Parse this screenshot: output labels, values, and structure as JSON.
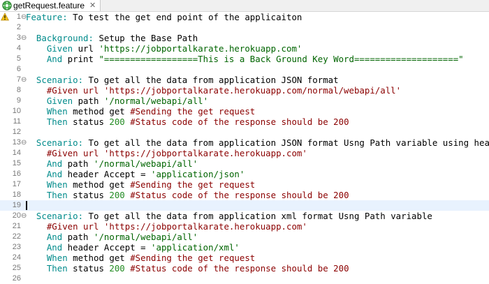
{
  "tab": {
    "title": "getRequest.feature",
    "close_icon": "✕",
    "icon": "cucumber-feature-icon"
  },
  "gutter": {
    "warning_icon": "warning-icon"
  },
  "colors": {
    "keyword": "#008b8b",
    "comment": "#8b0000",
    "string": "#006400",
    "number": "#228b22",
    "text": "#000000",
    "current_line": "#e8f2fe"
  },
  "current_line": 19,
  "lines": [
    {
      "num": "1",
      "fold": true,
      "warn": true,
      "tokens": [
        {
          "c": "kw",
          "t": "Feature:"
        },
        {
          "c": "tx",
          "t": " To test the get end point of the applicaiton"
        }
      ]
    },
    {
      "num": "2",
      "tokens": []
    },
    {
      "num": "3",
      "fold": true,
      "tokens": [
        {
          "c": "kw",
          "t": "  Background:"
        },
        {
          "c": "tx",
          "t": " Setup the Base Path"
        }
      ]
    },
    {
      "num": "4",
      "tokens": [
        {
          "c": "kw",
          "t": "    Given"
        },
        {
          "c": "tx",
          "t": " url "
        },
        {
          "c": "st",
          "t": "'https://jobportalkarate.herokuapp.com'"
        }
      ]
    },
    {
      "num": "5",
      "tokens": [
        {
          "c": "kw",
          "t": "    And"
        },
        {
          "c": "tx",
          "t": " print "
        },
        {
          "c": "st",
          "t": "\"==================This is a Back Ground Key Word====================\""
        }
      ]
    },
    {
      "num": "6",
      "tokens": []
    },
    {
      "num": "7",
      "fold": true,
      "tokens": [
        {
          "c": "kw",
          "t": "  Scenario:"
        },
        {
          "c": "tx",
          "t": " To get all the data from application JSON format"
        }
      ]
    },
    {
      "num": "8",
      "tokens": [
        {
          "c": "cm",
          "t": "    #Given url 'https://jobportalkarate.herokuapp.com/normal/webapi/all'"
        }
      ]
    },
    {
      "num": "9",
      "tokens": [
        {
          "c": "kw",
          "t": "    Given"
        },
        {
          "c": "tx",
          "t": " path "
        },
        {
          "c": "st",
          "t": "'/normal/webapi/all'"
        }
      ]
    },
    {
      "num": "10",
      "tokens": [
        {
          "c": "kw",
          "t": "    When"
        },
        {
          "c": "tx",
          "t": " method get "
        },
        {
          "c": "cm",
          "t": "#Sending the get request"
        }
      ]
    },
    {
      "num": "11",
      "tokens": [
        {
          "c": "kw",
          "t": "    Then"
        },
        {
          "c": "tx",
          "t": " status "
        },
        {
          "c": "nm",
          "t": "200"
        },
        {
          "c": "tx",
          "t": " "
        },
        {
          "c": "cm",
          "t": "#Status code of the response should be 200"
        }
      ]
    },
    {
      "num": "12",
      "tokens": []
    },
    {
      "num": "13",
      "fold": true,
      "tokens": [
        {
          "c": "kw",
          "t": "  Scenario:"
        },
        {
          "c": "tx",
          "t": " To get all the data from application JSON format Usng Path variable using header"
        }
      ]
    },
    {
      "num": "14",
      "tokens": [
        {
          "c": "cm",
          "t": "    #Given url 'https://jobportalkarate.herokuapp.com'"
        }
      ]
    },
    {
      "num": "15",
      "tokens": [
        {
          "c": "kw",
          "t": "    And"
        },
        {
          "c": "tx",
          "t": " path "
        },
        {
          "c": "st",
          "t": "'/normal/webapi/all'"
        }
      ]
    },
    {
      "num": "16",
      "tokens": [
        {
          "c": "kw",
          "t": "    And"
        },
        {
          "c": "tx",
          "t": " header Accept = "
        },
        {
          "c": "st",
          "t": "'application/json'"
        }
      ]
    },
    {
      "num": "17",
      "tokens": [
        {
          "c": "kw",
          "t": "    When"
        },
        {
          "c": "tx",
          "t": " method get "
        },
        {
          "c": "cm",
          "t": "#Sending the get request"
        }
      ]
    },
    {
      "num": "18",
      "tokens": [
        {
          "c": "kw",
          "t": "    Then"
        },
        {
          "c": "tx",
          "t": " status "
        },
        {
          "c": "nm",
          "t": "200"
        },
        {
          "c": "tx",
          "t": " "
        },
        {
          "c": "cm",
          "t": "#Status code of the response should be 200"
        }
      ]
    },
    {
      "num": "19",
      "tokens": []
    },
    {
      "num": "20",
      "fold": true,
      "tokens": [
        {
          "c": "kw",
          "t": "  Scenario:"
        },
        {
          "c": "tx",
          "t": " To get all the data from application xml format Usng Path variable"
        }
      ]
    },
    {
      "num": "21",
      "tokens": [
        {
          "c": "cm",
          "t": "    #Given url 'https://jobportalkarate.herokuapp.com'"
        }
      ]
    },
    {
      "num": "22",
      "tokens": [
        {
          "c": "kw",
          "t": "    And"
        },
        {
          "c": "tx",
          "t": " path "
        },
        {
          "c": "st",
          "t": "'/normal/webapi/all'"
        }
      ]
    },
    {
      "num": "23",
      "tokens": [
        {
          "c": "kw",
          "t": "    And"
        },
        {
          "c": "tx",
          "t": " header Accept = "
        },
        {
          "c": "st",
          "t": "'application/xml'"
        }
      ]
    },
    {
      "num": "24",
      "tokens": [
        {
          "c": "kw",
          "t": "    When"
        },
        {
          "c": "tx",
          "t": " method get "
        },
        {
          "c": "cm",
          "t": "#Sending the get request"
        }
      ]
    },
    {
      "num": "25",
      "tokens": [
        {
          "c": "kw",
          "t": "    Then"
        },
        {
          "c": "tx",
          "t": " status "
        },
        {
          "c": "nm",
          "t": "200"
        },
        {
          "c": "tx",
          "t": " "
        },
        {
          "c": "cm",
          "t": "#Status code of the response should be 200"
        }
      ]
    },
    {
      "num": "26",
      "tokens": []
    }
  ]
}
